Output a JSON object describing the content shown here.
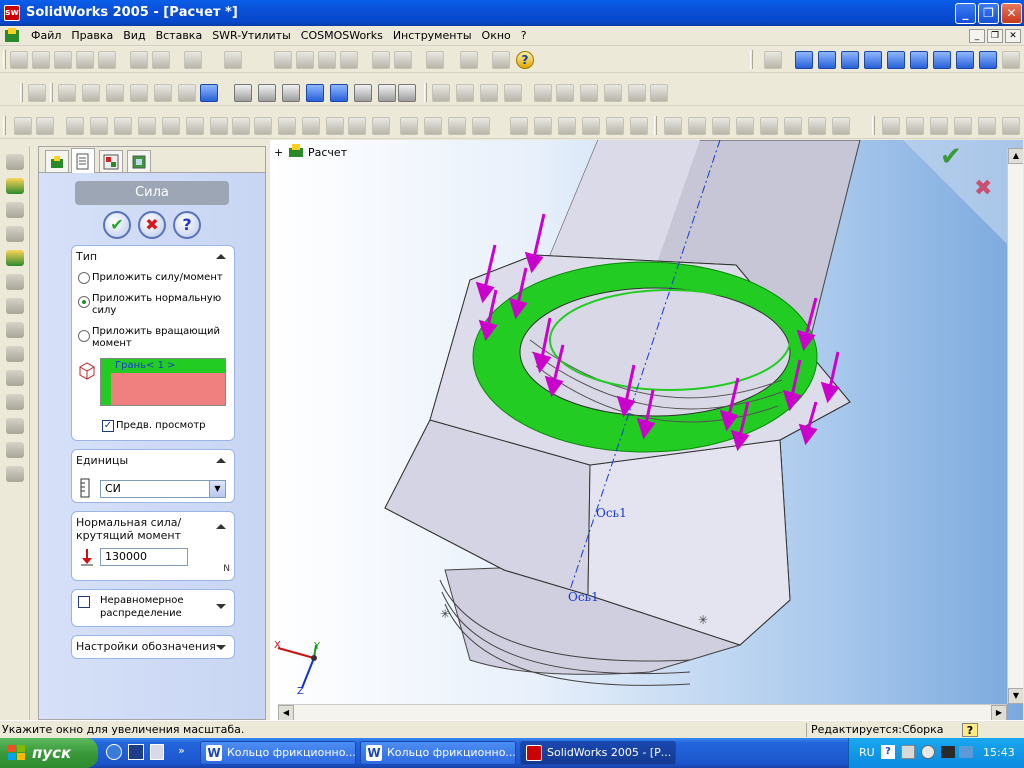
{
  "window": {
    "title": "SolidWorks 2005 - [Расчет *]",
    "app_icon": "sw",
    "controls": {
      "minimize": "_",
      "restore": "❐",
      "close": "✕"
    }
  },
  "menu": {
    "items": [
      "Файл",
      "Правка",
      "Вид",
      "Вставка",
      "SWR-Утилиты",
      "COSMOSWorks",
      "Инструменты",
      "Окно",
      "?"
    ],
    "doc_controls": {
      "minimize": "_",
      "restore": "❐",
      "close": "✕"
    }
  },
  "toolbar": {
    "help_glyph": "?"
  },
  "panel": {
    "tabs": [
      "feature-manager",
      "property-manager",
      "configuration-manager",
      "cosmos-manager"
    ],
    "title": "Сила",
    "ok": "✔",
    "cancel": "✖",
    "help": "?",
    "type_group": {
      "header": "Тип",
      "options": [
        "Приложить силу/момент",
        "Приложить нормальную силу",
        "Приложить вращающий момент"
      ],
      "selected_index": 1,
      "selection_list": [
        "Грань< 1 >"
      ],
      "preview_label": "Предв. просмотр",
      "preview_checked": true
    },
    "units_group": {
      "header": "Единицы",
      "value": "СИ"
    },
    "force_group": {
      "header": "Нормальная сила/ крутящий момент",
      "value": "130000",
      "unit_hint": "N"
    },
    "nonuniform_group": {
      "label": "Неравномерное распределение",
      "checked": false
    },
    "symbol_group": {
      "header": "Настройки обозначения"
    }
  },
  "graphics": {
    "tree_label": "Расчет",
    "tree_expand": "+",
    "axis_label": "Ось1",
    "axis_label_2": "Ось1",
    "triad": {
      "x": "X",
      "y": "Y",
      "z": "Z"
    },
    "confirm_ok": "✔",
    "confirm_cancel": "✖",
    "colors": {
      "selected_face": "#22cc22",
      "force_arrow": "#cc00cc",
      "axis": "#1a3acc"
    }
  },
  "statusbar": {
    "hint": "Укажите окно для увеличения масштаба.",
    "mode": "Редактируется:Сборка",
    "help": "?"
  },
  "taskbar": {
    "start": "пуск",
    "tasks": [
      "Кольцо фрикционно...",
      "Кольцо фрикционно...",
      "SolidWorks 2005 - [Р..."
    ],
    "active_task": 2,
    "tray": {
      "lang": "RU",
      "time": "15:43"
    }
  }
}
